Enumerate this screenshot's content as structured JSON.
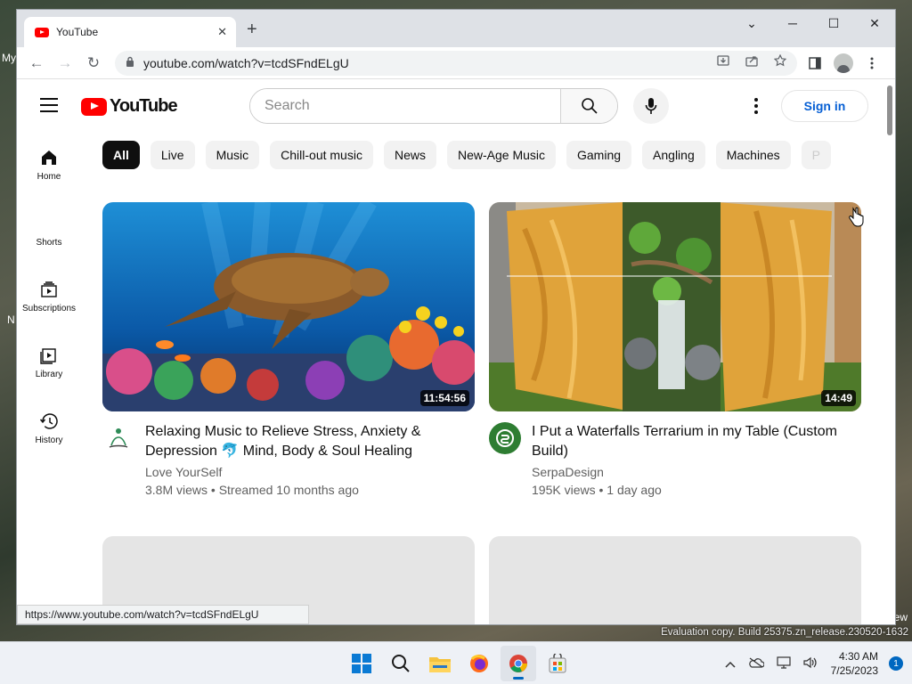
{
  "desktop": {
    "left_label_1": "My",
    "left_label_2": "N",
    "right_label": "ew",
    "eval_text": "Evaluation copy. Build 25375.zn_release.230520-1632"
  },
  "browser": {
    "tab": {
      "title": "YouTube",
      "close": "✕"
    },
    "new_tab": "+",
    "window_controls": {
      "tab_search": "⌄",
      "minimize": "─",
      "maximize": "☐",
      "close": "✕"
    },
    "nav": {
      "back": "←",
      "forward": "→",
      "reload": "↻"
    },
    "url": "youtube.com/watch?v=tcdSFndELgU",
    "status_url": "https://www.youtube.com/watch?v=tcdSFndELgU"
  },
  "youtube": {
    "logo_text": "YouTube",
    "search": {
      "placeholder": "Search"
    },
    "sign_in": "Sign in",
    "guide": [
      {
        "label": "Home",
        "icon": "home-icon"
      },
      {
        "label": "Shorts",
        "icon": "shorts-icon"
      },
      {
        "label": "Subscriptions",
        "icon": "subscriptions-icon"
      },
      {
        "label": "Library",
        "icon": "library-icon"
      },
      {
        "label": "History",
        "icon": "history-icon"
      }
    ],
    "chips": [
      "All",
      "Live",
      "Music",
      "Chill-out music",
      "News",
      "New-Age Music",
      "Gaming",
      "Angling",
      "Machines",
      "P"
    ],
    "videos": [
      {
        "title": "Relaxing Music to Relieve Stress, Anxiety & Depression 🐬 Mind, Body & Soul Healing",
        "channel": "Love YourSelf",
        "stats": "3.8M views • Streamed 10 months ago",
        "duration": "11:54:56"
      },
      {
        "title": "I Put a Waterfalls Terrarium in my Table (Custom Build)",
        "channel": "SerpaDesign",
        "stats": "195K views • 1 day ago",
        "duration": "14:49"
      }
    ]
  },
  "taskbar": {
    "time": "4:30 AM",
    "date": "7/25/2023",
    "notifications": "1"
  },
  "colors": {
    "youtube_red": "#ff0000",
    "link_blue": "#065fd4",
    "accent": "#0067c0"
  }
}
